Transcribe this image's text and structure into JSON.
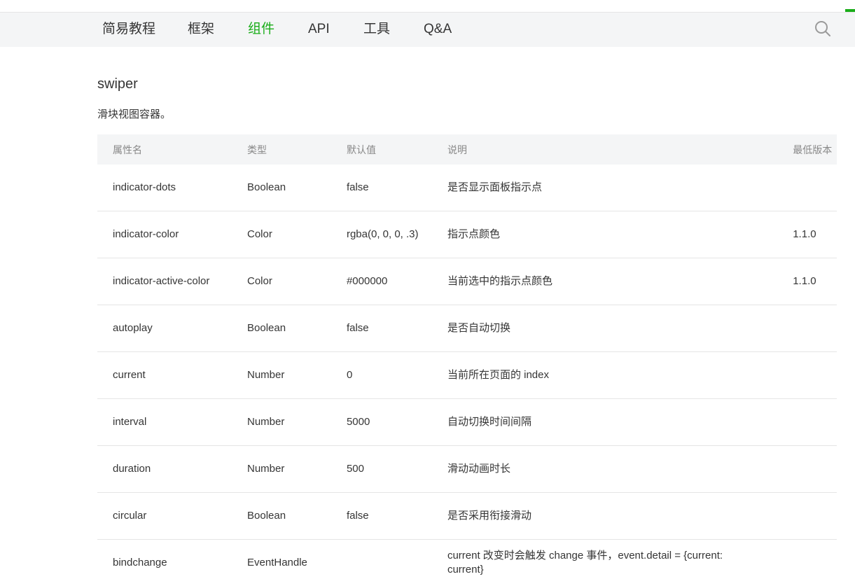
{
  "nav": {
    "items": [
      {
        "label": "简易教程",
        "active": false
      },
      {
        "label": "框架",
        "active": false
      },
      {
        "label": "组件",
        "active": true
      },
      {
        "label": "API",
        "active": false
      },
      {
        "label": "工具",
        "active": false
      },
      {
        "label": "Q&A",
        "active": false
      }
    ],
    "search_icon": "search-icon"
  },
  "page": {
    "title": "swiper",
    "description": "滑块视图容器。"
  },
  "table": {
    "headers": [
      "属性名",
      "类型",
      "默认值",
      "说明",
      "最低版本"
    ],
    "rows": [
      {
        "name": "indicator-dots",
        "type": "Boolean",
        "default": "false",
        "desc": "是否显示面板指示点",
        "version": ""
      },
      {
        "name": "indicator-color",
        "type": "Color",
        "default": "rgba(0, 0, 0, .3)",
        "desc": "指示点颜色",
        "version": "1.1.0"
      },
      {
        "name": "indicator-active-color",
        "type": "Color",
        "default": "#000000",
        "desc": "当前选中的指示点颜色",
        "version": "1.1.0"
      },
      {
        "name": "autoplay",
        "type": "Boolean",
        "default": "false",
        "desc": "是否自动切换",
        "version": ""
      },
      {
        "name": "current",
        "type": "Number",
        "default": "0",
        "desc": "当前所在页面的 index",
        "version": ""
      },
      {
        "name": "interval",
        "type": "Number",
        "default": "5000",
        "desc": "自动切换时间间隔",
        "version": ""
      },
      {
        "name": "duration",
        "type": "Number",
        "default": "500",
        "desc": "滑动动画时长",
        "version": ""
      },
      {
        "name": "circular",
        "type": "Boolean",
        "default": "false",
        "desc": "是否采用衔接滑动",
        "version": ""
      },
      {
        "name": "bindchange",
        "type": "EventHandle",
        "default": "",
        "desc": "current 改变时会触发 change 事件，event.detail = {current: current}",
        "version": ""
      }
    ]
  },
  "colors": {
    "accent": "#1aad19",
    "version_link": "#586c94",
    "header_bg": "#f4f5f6"
  }
}
